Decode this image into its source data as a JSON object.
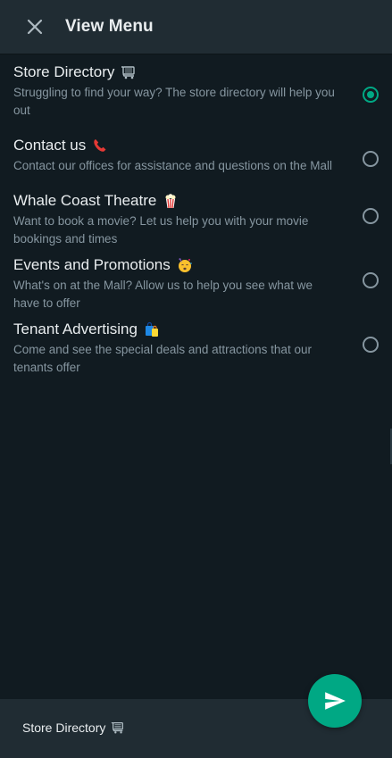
{
  "header": {
    "title": "View Menu",
    "close_icon": "close-icon"
  },
  "menu": {
    "items": [
      {
        "title": "Store Directory",
        "emoji": "shopping-cart-icon",
        "description": "Struggling to find your way? The store directory will help you out",
        "selected": true
      },
      {
        "title": "Contact us",
        "emoji": "telephone-receiver-icon",
        "description": "Contact our offices for assistance and questions on the Mall",
        "selected": false
      },
      {
        "title": "Whale Coast Theatre",
        "emoji": "popcorn-icon",
        "description": "Want to book a movie? Let us help you with your movie bookings and times",
        "selected": false
      },
      {
        "title": "Events and Promotions",
        "emoji": "party-face-icon",
        "description": "What's on at the Mall? Allow us to help you see what we have to offer",
        "selected": false
      },
      {
        "title": "Tenant Advertising",
        "emoji": "shopping-bags-icon",
        "description": "Come and see the special deals and attractions that our tenants offer",
        "selected": false
      }
    ]
  },
  "footer": {
    "selection_label": "Store Directory",
    "selection_emoji": "shopping-cart-icon",
    "send_icon": "send-icon"
  },
  "colors": {
    "background": "#111b21",
    "header_bg": "#202c33",
    "accent": "#00a884",
    "primary_text": "#e9edef",
    "secondary_text": "#8696a0"
  }
}
